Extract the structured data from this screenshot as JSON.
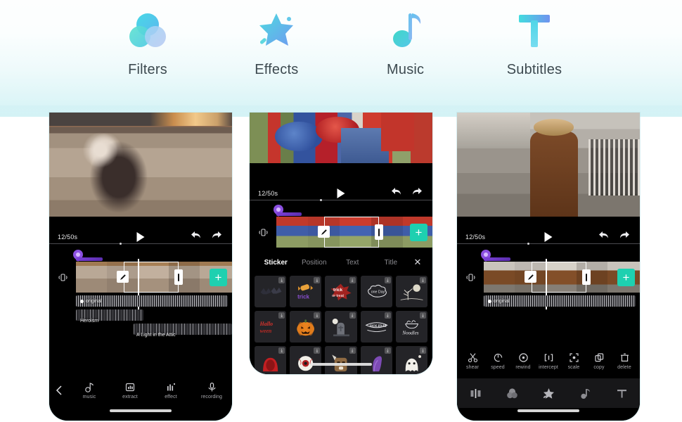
{
  "hero": {
    "items": [
      {
        "label": "Filters",
        "icon": "filters-circles-icon"
      },
      {
        "label": "Effects",
        "icon": "sparkle-star-icon"
      },
      {
        "label": "Music",
        "icon": "music-note-icon"
      },
      {
        "label": "Subtitles",
        "icon": "text-t-icon"
      }
    ]
  },
  "colors": {
    "accent_cyan": "#4fd8e8",
    "accent_blue": "#6aa8f0",
    "accent_teal_add": "#1ed0b0",
    "sticker_purple": "#8b4fe0",
    "hero_bg_bottom": "#d3f2f5",
    "screen_black": "#000000"
  },
  "phone1": {
    "transport": {
      "time_code": "12/50s",
      "play": "play-icon",
      "undo": "undo-icon",
      "redo": "redo-icon"
    },
    "timeline": {
      "vibrate_icon": "vibrate-icon",
      "sticker_marker": "sticker-pin-icon",
      "edit_icon": "pencil-icon",
      "trim_handle": "trim-handle",
      "add_label": "+",
      "audio_tracks": [
        {
          "label": "original",
          "has_mic_dot": true
        },
        {
          "label": "Heroism",
          "has_mic_dot": false
        },
        {
          "label": "A Light in the Attic",
          "has_mic_dot": false
        }
      ]
    },
    "toolbar": {
      "back": "back-chevron-icon",
      "items": [
        {
          "label": "music",
          "icon": "music-note-icon"
        },
        {
          "label": "extract",
          "icon": "extract-icon"
        },
        {
          "label": "effect",
          "icon": "effect-bars-icon"
        },
        {
          "label": "recording",
          "icon": "microphone-icon"
        }
      ]
    }
  },
  "phone2": {
    "transport": {
      "time_code": "12/50s",
      "play": "play-icon",
      "undo": "undo-icon",
      "redo": "redo-icon"
    },
    "timeline": {
      "vibrate_icon": "vibrate-icon",
      "sticker_marker": "sticker-pin-icon",
      "edit_icon": "pencil-icon",
      "add_label": "+"
    },
    "panel": {
      "tabs": [
        {
          "label": "Sticker",
          "active": true
        },
        {
          "label": "Position",
          "active": false
        },
        {
          "label": "Text",
          "active": false
        },
        {
          "label": "Title",
          "active": false
        }
      ],
      "close_icon": "close-x-icon",
      "stickers": [
        {
          "name": "bats-sticker",
          "kind": "bats"
        },
        {
          "name": "candy-sticker",
          "kind": "candy"
        },
        {
          "name": "trick-or-treat-sticker",
          "kind": "trick"
        },
        {
          "name": "one-day-cloud-sticker",
          "kind": "cloud"
        },
        {
          "name": "moon-tree-sticker",
          "kind": "moontree"
        },
        {
          "name": "halloween-text-sticker",
          "kind": "hallo"
        },
        {
          "name": "pumpkin-sticker",
          "kind": "pumpkin"
        },
        {
          "name": "tombstone-sticker",
          "kind": "tomb"
        },
        {
          "name": "holiday-badge-sticker",
          "kind": "badge"
        },
        {
          "name": "noodles-sticker",
          "kind": "noodles"
        },
        {
          "name": "red-hood-sticker",
          "kind": "hood"
        },
        {
          "name": "eyeball-sticker",
          "kind": "eye"
        },
        {
          "name": "dog-sticker",
          "kind": "dog"
        },
        {
          "name": "purple-ghost-sticker",
          "kind": "pghost"
        },
        {
          "name": "white-ghost-sticker",
          "kind": "wghost"
        }
      ],
      "download_badge": "download-icon"
    }
  },
  "phone3": {
    "transport": {
      "time_code": "12/50s",
      "play": "play-icon",
      "undo": "undo-icon",
      "redo": "redo-icon"
    },
    "timeline": {
      "vibrate_icon": "vibrate-icon",
      "sticker_marker": "sticker-pin-icon",
      "edit_icon": "pencil-icon",
      "add_label": "+",
      "audio_tracks": [
        {
          "label": "original",
          "has_mic_dot": true
        }
      ]
    },
    "toolbar": {
      "items": [
        {
          "label": "shear",
          "icon": "scissors-icon"
        },
        {
          "label": "speed",
          "icon": "speed-gauge-icon"
        },
        {
          "label": "rewind",
          "icon": "rewind-circle-icon"
        },
        {
          "label": "intercept",
          "icon": "intercept-brackets-icon"
        },
        {
          "label": "scale",
          "icon": "scale-focus-icon"
        },
        {
          "label": "copy",
          "icon": "copy-icon"
        },
        {
          "label": "delete",
          "icon": "trash-icon"
        }
      ]
    },
    "navbar": {
      "items": [
        {
          "name": "clip-edit-icon"
        },
        {
          "name": "filters-circles-icon"
        },
        {
          "name": "effects-star-icon"
        },
        {
          "name": "music-note-icon"
        },
        {
          "name": "text-t-icon"
        }
      ]
    }
  }
}
